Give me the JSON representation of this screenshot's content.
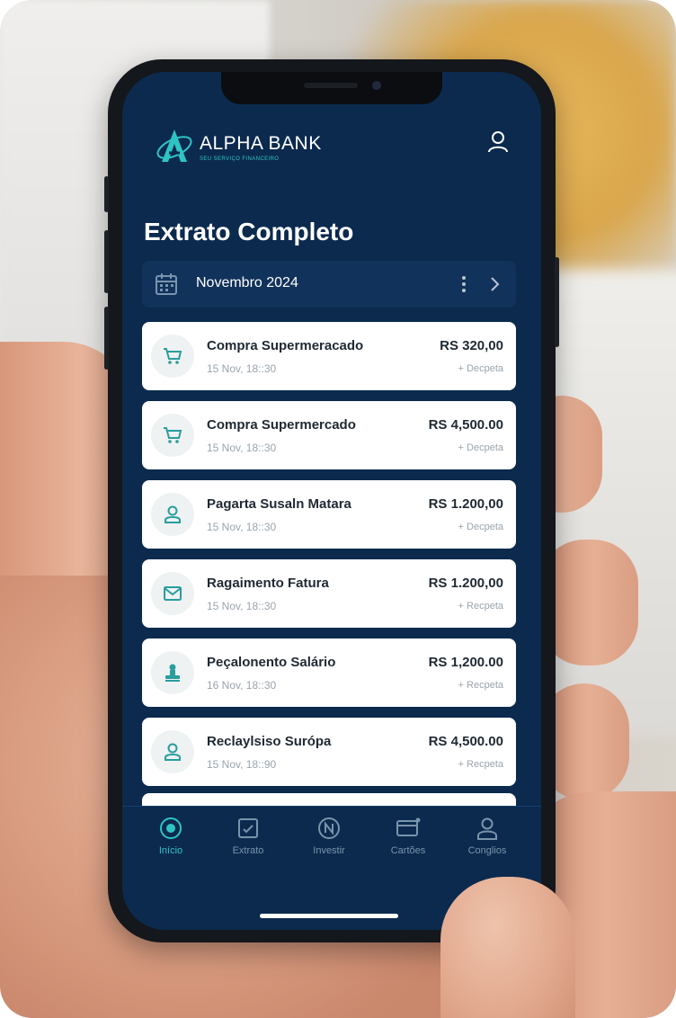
{
  "app": {
    "brand_name": "ALPHA BANK",
    "brand_tagline": "SEU SERVIÇO FINANCEIRO"
  },
  "page": {
    "title": "Extrato Completo"
  },
  "month_selector": {
    "label": "Novembro 2024"
  },
  "transactions": [
    {
      "title": "Compra Supermeracado",
      "date": "15 Nov, 18::30",
      "amount": "RS 320,00",
      "type": "+ Decpeta",
      "icon": "cart-icon"
    },
    {
      "title": "Compra Supermercado",
      "date": "15 Nov, 18::30",
      "amount": "RS 4,500.00",
      "type": "+ Decpeta",
      "icon": "cart-icon"
    },
    {
      "title": "Pagarta Susaln Matara",
      "date": "15 Nov, 18::30",
      "amount": "RS 1.200,00",
      "type": "+ Decpeta",
      "icon": "user-icon"
    },
    {
      "title": "Ragaimento Fatura",
      "date": "15 Nov, 18::30",
      "amount": "RS 1.200,00",
      "type": "+ Recpeta",
      "icon": "envelope-icon"
    },
    {
      "title": "Peçalonento Salário",
      "date": "16 Nov, 18::30",
      "amount": "RS 1,200.00",
      "type": "+ Recpeta",
      "icon": "stamp-icon"
    },
    {
      "title": "Reclaylsiso Surópa",
      "date": "15 Nov, 18::90",
      "amount": "RS 4,500.00",
      "type": "+ Recpeta",
      "icon": "user-icon"
    }
  ],
  "bottom_nav": [
    {
      "label": "Início",
      "icon": "home-icon",
      "active": true
    },
    {
      "label": "Extrato",
      "icon": "statement-icon",
      "active": false
    },
    {
      "label": "Investir",
      "icon": "invest-icon",
      "active": false
    },
    {
      "label": "Cartões",
      "icon": "card-icon",
      "active": false
    },
    {
      "label": "Conglios",
      "icon": "profile-icon",
      "active": false
    }
  ],
  "colors": {
    "screen_bg": "#0b2a4e",
    "accent": "#2fc4c4",
    "card_bg": "#ffffff"
  }
}
